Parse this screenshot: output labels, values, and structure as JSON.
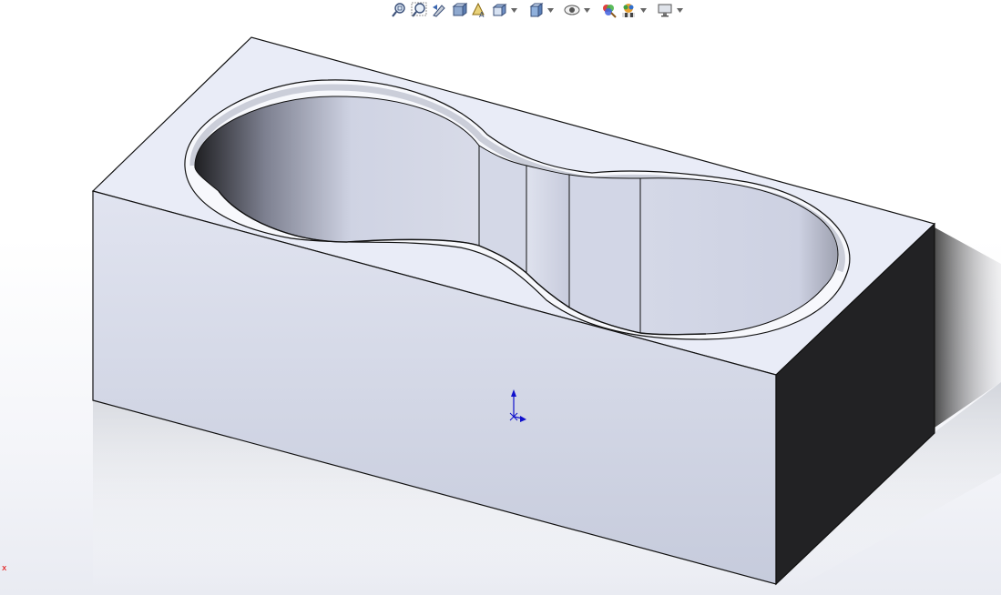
{
  "toolbar": {
    "items": [
      {
        "name": "zoom-to-fit-icon",
        "dropdown": false
      },
      {
        "name": "zoom-to-area-icon",
        "dropdown": false
      },
      {
        "name": "previous-view-icon",
        "dropdown": false
      },
      {
        "name": "section-view-icon",
        "dropdown": false
      },
      {
        "name": "dynamic-annotation-views-icon",
        "dropdown": false
      },
      {
        "name": "view-orientation-icon",
        "dropdown": true
      },
      {
        "name": "display-style-icon",
        "dropdown": true
      },
      {
        "name": "hide-show-items-icon",
        "dropdown": true
      },
      {
        "name": "edit-appearance-icon",
        "dropdown": false
      },
      {
        "name": "apply-scene-icon",
        "dropdown": true
      },
      {
        "name": "view-settings-icon",
        "dropdown": true
      }
    ]
  },
  "origin_marker": {
    "label": "x",
    "color": "#e00000"
  },
  "colors": {
    "face_top": "#e9ecf7",
    "face_front": "#cdd2e3",
    "face_side": "#222224",
    "edge": "#111111",
    "triad": "#1010cc"
  }
}
